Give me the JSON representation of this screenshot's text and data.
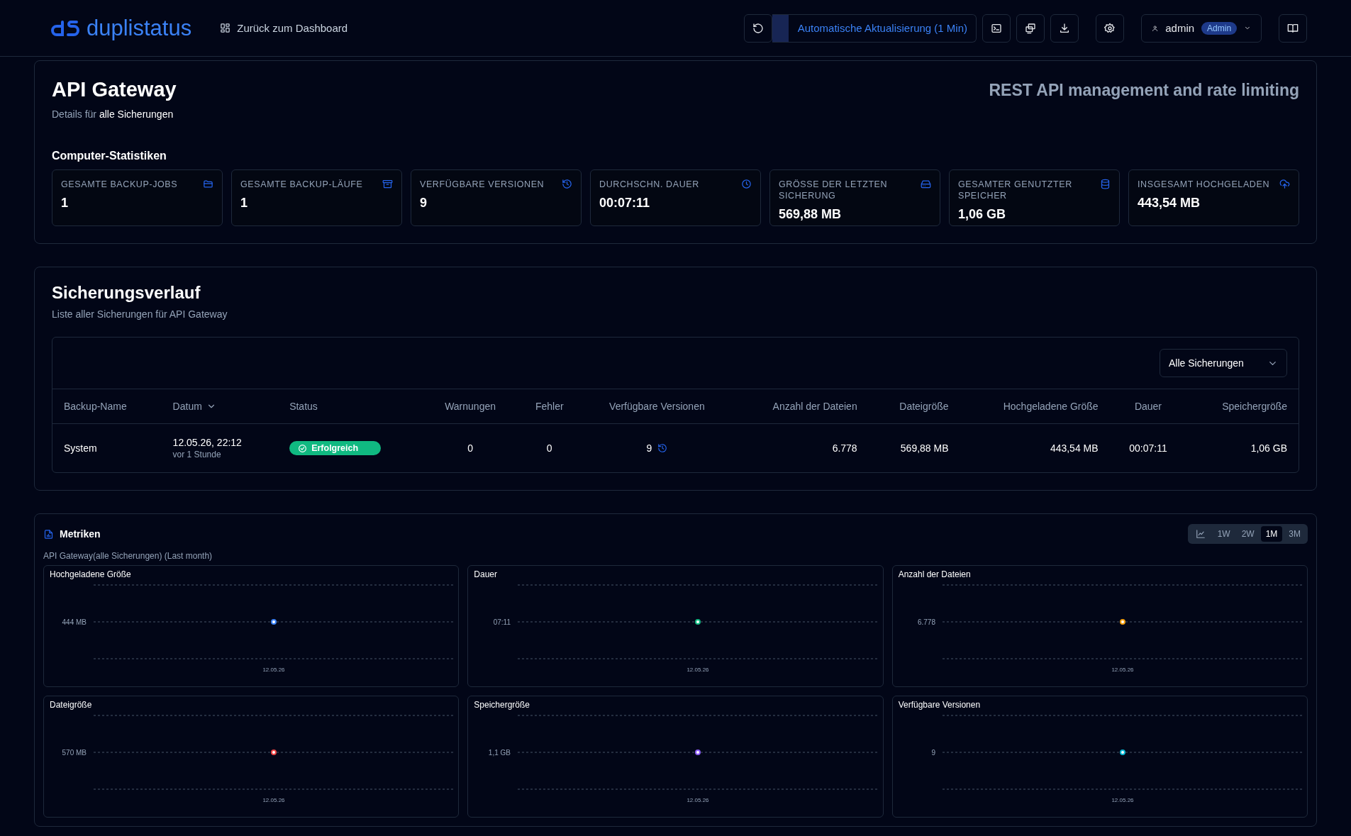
{
  "header": {
    "logo": "duplistatus",
    "back_link": "Zurück zum Dashboard",
    "auto_refresh": {
      "label": "Automatische Aktualisierung (1 Min)",
      "level": 0.08
    },
    "user": {
      "name": "admin",
      "role": "Admin"
    }
  },
  "server": {
    "title": "API Gateway",
    "subtitle_prefix": "Details für",
    "subtitle_target": "alle Sicherungen",
    "description": "REST API management and rate limiting"
  },
  "stats": {
    "title": "Computer-Statistiken",
    "items": [
      {
        "label": "GESAMTE BACKUP-JOBS",
        "value": "1",
        "kind": "folder"
      },
      {
        "label": "GESAMTE BACKUP-LÄUFE",
        "value": "1",
        "kind": "archive"
      },
      {
        "label": "VERFÜGBARE VERSIONEN",
        "value": "9",
        "kind": "history"
      },
      {
        "label": "DURCHSCHN. DAUER",
        "value": "00:07:11",
        "kind": "clock"
      },
      {
        "label": "GRÖSSE DER LETZTEN SICHERUNG",
        "value": "569,88 MB",
        "kind": "drive"
      },
      {
        "label": "GESAMTER GENUTZTER SPEICHER",
        "value": "1,06 GB",
        "kind": "database"
      },
      {
        "label": "INSGESAMT HOCHGELADEN",
        "value": "443,54 MB",
        "kind": "upload"
      }
    ]
  },
  "history": {
    "title": "Sicherungsverlauf",
    "subtitle": "Liste aller Sicherungen für API Gateway",
    "filter": "Alle Sicherungen",
    "columns": [
      {
        "label": "Backup-Name",
        "sorted": false
      },
      {
        "label": "Datum",
        "sorted": true
      },
      {
        "label": "Status",
        "sorted": false
      },
      {
        "label": "Warnungen",
        "sorted": false
      },
      {
        "label": "Fehler",
        "sorted": false
      },
      {
        "label": "Verfügbare Versionen",
        "sorted": false
      },
      {
        "label": "Anzahl der Dateien",
        "sorted": false
      },
      {
        "label": "Dateigröße",
        "sorted": false
      },
      {
        "label": "Hochgeladene Größe",
        "sorted": false
      },
      {
        "label": "Dauer",
        "sorted": false
      },
      {
        "label": "Speichergröße",
        "sorted": false
      }
    ],
    "rows": [
      {
        "name": "System",
        "date": "12.05.26, 22:12",
        "ago": "vor 1 Stunde",
        "status": {
          "label": "Erfolgreich",
          "kind": "success"
        },
        "warnings": "0",
        "errors": "0",
        "versions": "9",
        "files": "6.778",
        "file_size": "569,88 MB",
        "uploaded": "443,54 MB",
        "duration": "00:07:11",
        "storage": "1,06 GB"
      }
    ]
  },
  "metrics": {
    "title": "Metriken",
    "subtitle": "API Gateway(alle Sicherungen) (Last month)",
    "ranges": [
      {
        "label": "1W",
        "selected": false
      },
      {
        "label": "2W",
        "selected": false
      },
      {
        "label": "1M",
        "selected": true
      },
      {
        "label": "3M",
        "selected": false
      }
    ],
    "charts": [
      {
        "title": "Hochgeladene Größe",
        "y_label": "444 MB",
        "x_label": "12.05.26",
        "color": "#3b82f6"
      },
      {
        "title": "Dauer",
        "y_label": "07:11",
        "x_label": "12.05.26",
        "color": "#10b981"
      },
      {
        "title": "Anzahl der Dateien",
        "y_label": "6.778",
        "x_label": "12.05.26",
        "color": "#f59e0b"
      },
      {
        "title": "Dateigröße",
        "y_label": "570 MB",
        "x_label": "12.05.26",
        "color": "#ef4444"
      },
      {
        "title": "Speichergröße",
        "y_label": "1,1 GB",
        "x_label": "12.05.26",
        "color": "#8b5cf6"
      },
      {
        "title": "Verfügbare Versionen",
        "y_label": "9",
        "x_label": "12.05.26",
        "color": "#06b6d4"
      }
    ]
  }
}
